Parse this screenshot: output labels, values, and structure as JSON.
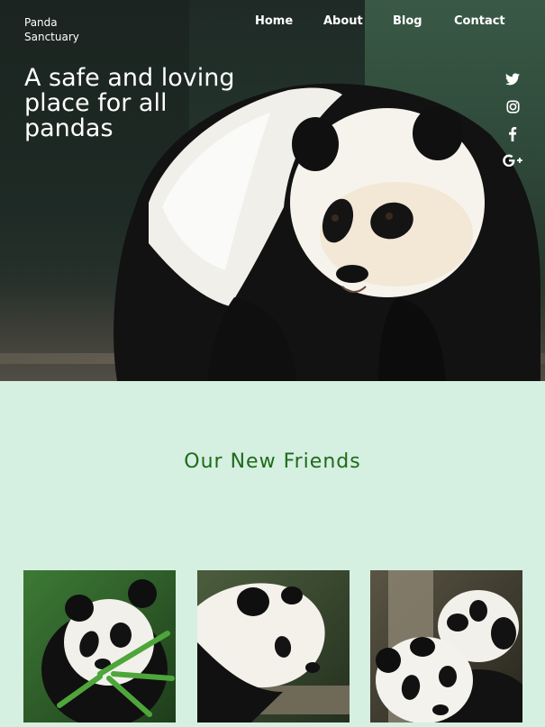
{
  "brand": {
    "line1": "Panda",
    "line2": "Sanctuary"
  },
  "nav": {
    "items": [
      "Home",
      "About",
      "Blog",
      "Contact"
    ]
  },
  "hero": {
    "headline_line1": "A safe and loving",
    "headline_line2": "place for all",
    "headline_line3": "pandas",
    "image_icon": "panda-photo"
  },
  "social": [
    {
      "name": "twitter",
      "icon": "twitter-icon"
    },
    {
      "name": "instagram",
      "icon": "instagram-icon"
    },
    {
      "name": "facebook",
      "icon": "facebook-icon"
    },
    {
      "name": "google-plus",
      "icon": "google-plus-icon"
    }
  ],
  "section": {
    "title": "Our New Friends"
  },
  "gallery": [
    {
      "name": "panda-eating-bamboo"
    },
    {
      "name": "panda-profile-log"
    },
    {
      "name": "panda-pair-cuddling"
    }
  ],
  "colors": {
    "section_bg": "#d5efe1",
    "section_title": "#1e6b1a",
    "hero_text": "#ffffff"
  }
}
